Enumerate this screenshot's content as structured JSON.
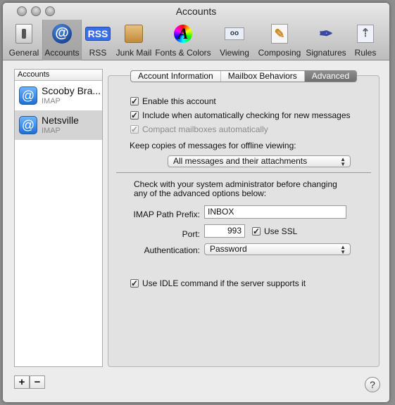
{
  "window": {
    "title": "Accounts"
  },
  "toolbar": [
    {
      "label": "General",
      "icon": "switch-icon"
    },
    {
      "label": "Accounts",
      "icon": "at-icon",
      "selected": true
    },
    {
      "label": "RSS",
      "icon": "rss-icon"
    },
    {
      "label": "Junk Mail",
      "icon": "junk-mail-icon"
    },
    {
      "label": "Fonts & Colors",
      "icon": "color-wheel-icon"
    },
    {
      "label": "Viewing",
      "icon": "glasses-icon"
    },
    {
      "label": "Composing",
      "icon": "pencil-paper-icon"
    },
    {
      "label": "Signatures",
      "icon": "pen-icon"
    },
    {
      "label": "Rules",
      "icon": "rules-arrows-icon"
    }
  ],
  "sidebar": {
    "header": "Accounts",
    "items": [
      {
        "name": "Scooby Bra...",
        "type": "IMAP"
      },
      {
        "name": "Netsville",
        "type": "IMAP",
        "selected": true
      }
    ],
    "add": "+",
    "remove": "−"
  },
  "tabs": [
    {
      "label": "Account Information"
    },
    {
      "label": "Mailbox Behaviors"
    },
    {
      "label": "Advanced",
      "selected": true
    }
  ],
  "advanced": {
    "enable": {
      "label": "Enable this account",
      "checked": true
    },
    "include": {
      "label": "Include when automatically checking for new messages",
      "checked": true
    },
    "compact": {
      "label": "Compact mailboxes automatically",
      "checked": true,
      "disabled": true
    },
    "keep_label": "Keep copies of messages for offline viewing:",
    "keep_value": "All messages and their attachments",
    "warning": "Check with your system administrator before changing any of the advanced options below:",
    "prefix_label": "IMAP Path Prefix:",
    "prefix_value": "INBOX",
    "port_label": "Port:",
    "port_value": "993",
    "ssl": {
      "label": "Use SSL",
      "checked": true
    },
    "auth_label": "Authentication:",
    "auth_value": "Password",
    "idle": {
      "label": "Use IDLE command if the server supports it",
      "checked": true
    }
  },
  "help": "?"
}
